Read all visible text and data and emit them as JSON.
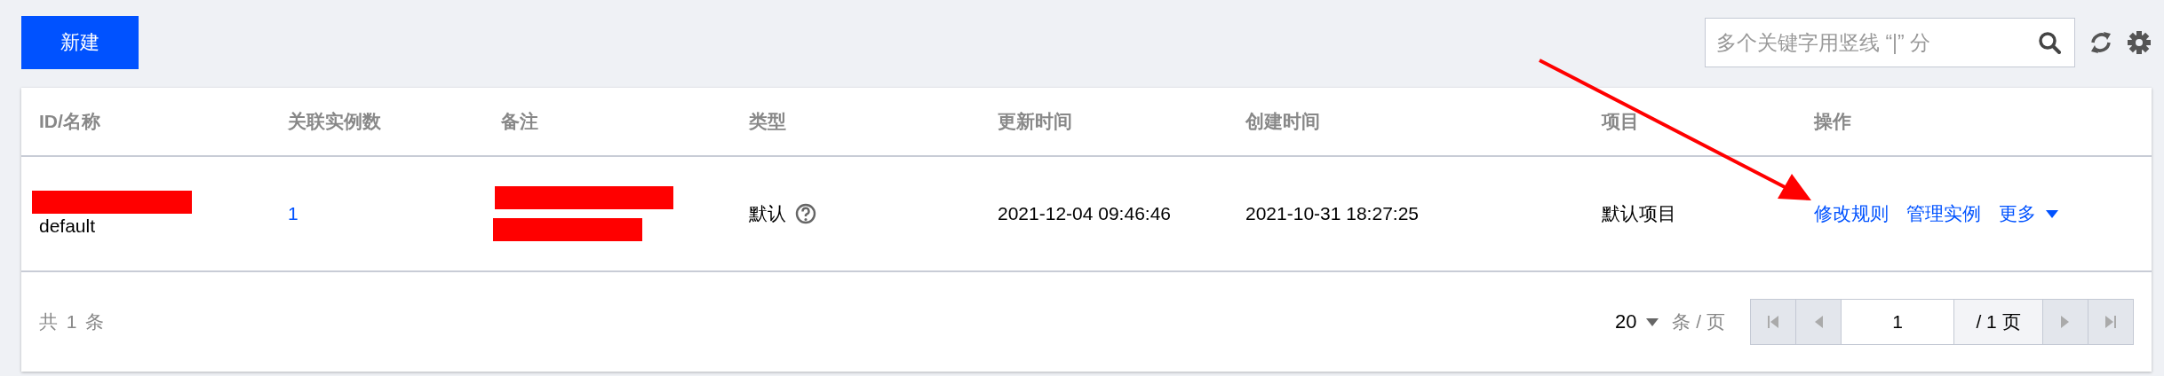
{
  "toolbar": {
    "new_button": "新建",
    "search": {
      "placeholder": "多个关键字用竖线 “|” 分"
    }
  },
  "table": {
    "columns": [
      "ID/名称",
      "关联实例数",
      "备注",
      "类型",
      "更新时间",
      "创建时间",
      "项目",
      "操作"
    ],
    "rows": [
      {
        "id_redacted": true,
        "name": "default",
        "instances": "1",
        "note_redacted": true,
        "type": "默认",
        "updated": "2021-12-04 09:46:46",
        "created": "2021-10-31 18:27:25",
        "project": "默认项目",
        "actions": [
          "修改规则",
          "管理实例",
          "更多"
        ]
      }
    ]
  },
  "footer": {
    "total": "共 1 条",
    "page_size": "20",
    "page_size_unit": "条 / 页",
    "page": "1",
    "page_total": "/ 1 页"
  },
  "annotation": {
    "arrow": true
  }
}
